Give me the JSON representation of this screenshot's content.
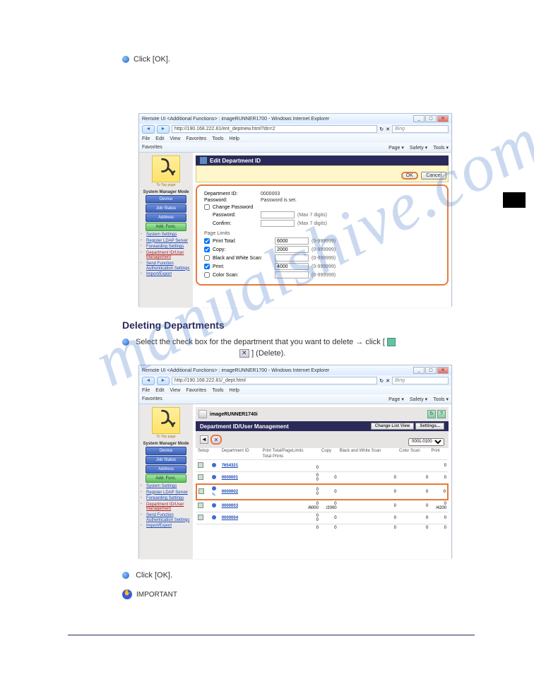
{
  "watermark": "manualshive.com",
  "instr": {
    "limit_row_hint": "(0-999999)",
    "ok_step": "Click [OK].",
    "delete_title": "Deleting Departments",
    "delete_step1_a": "Select the check box for the department that you want to delete → click [",
    "delete_step1_b": "] (Delete).",
    "delete_step2": "Click [OK].",
    "important": "IMPORTANT"
  },
  "browser": {
    "title1": "Remote UI <Additional Functions> : imageRUNNER1700 - Windows Internet Explorer",
    "title2": "Remote UI <Additional Functions> : imageRUNNER1700 - Windows Internet Explorer",
    "url1": "http://190.168.222.81/ent_deptnew.html?dn=2",
    "url2": "http://190.168.222.81/_dept.html",
    "search": "Bing",
    "menus": [
      "File",
      "Edit",
      "View",
      "Favorites",
      "Tools",
      "Help"
    ],
    "tb": [
      "Favorites",
      "",
      "",
      "",
      "",
      "Page ▾",
      "Safety ▾",
      "Tools ▾",
      ""
    ]
  },
  "sidebar": {
    "logo_caption": "To Top page",
    "mode": "System Manager Mode",
    "btns": [
      "Device",
      "Job Status",
      "Address",
      "Add. Func."
    ],
    "links": [
      "System Settings",
      "Register LDAP Server",
      "Forwarding Settings",
      "Department ID/User Management",
      "Send Function Authentication Settings",
      "Import/Export"
    ]
  },
  "edit": {
    "title": "Edit Department ID",
    "ok": "OK",
    "cancel": "Cancel",
    "dept_label": "Department ID:",
    "dept_val": "0000003",
    "pw_label": "Password:",
    "pw_val": "Password is set.",
    "change_pw": "Change Password",
    "new_pw": "Password:",
    "confirm": "Confirm:",
    "max7": "(Max 7 digits)",
    "page_limits": "Page Limits",
    "rows": [
      {
        "label": "Print Total:",
        "val": "6000",
        "chk": true
      },
      {
        "label": "Copy:",
        "val": "2000",
        "chk": true
      },
      {
        "label": "Black and White Scan:",
        "val": "",
        "chk": false
      },
      {
        "label": "Print:",
        "val": "4000",
        "chk": true
      },
      {
        "label": "Color Scan:",
        "val": "",
        "chk": false
      }
    ],
    "range": "(0-999999)"
  },
  "list": {
    "product": "imageRUNNER1740i",
    "title": "Department ID/User Management",
    "change_list": "Change List View",
    "settings": "Settings...",
    "pager": "0001-0100",
    "cols": [
      "Setup",
      "Department ID",
      "Print Total/PageLimits",
      "",
      "Copy",
      "",
      "Black and White Scan",
      "Color Scan",
      "",
      "Print",
      ""
    ],
    "sub": "Total Prints",
    "rows": [
      {
        "id": "7654321",
        "pt": "",
        "pt2": "0",
        "copy": "",
        "bw": "",
        "cs": "",
        "pr": "0"
      },
      {
        "id": "0000001",
        "pt": "0",
        "pt2": "0",
        "copy": "0",
        "bw": "0",
        "cs": "0",
        "pr": "0"
      },
      {
        "id": "0000002",
        "pt": "0",
        "pt2": "0",
        "copy": "0",
        "bw": "0",
        "cs": "0",
        "pr": "0",
        "hl": true
      },
      {
        "id": "0000003",
        "pt": "0",
        "pt2": "/6000",
        "copy": "0",
        "copy2": "/2000",
        "bw": "0",
        "cs": "0",
        "pr": "0",
        "pr2": "/4200"
      },
      {
        "id": "0000004",
        "pt": "0",
        "pt2": "0",
        "copy": "0",
        "bw": "0",
        "cs": "0",
        "pr": "0"
      }
    ],
    "footer_row": {
      "pt": "0",
      "copy": "0",
      "bw": "0",
      "cs": "0",
      "pr": "0"
    }
  }
}
